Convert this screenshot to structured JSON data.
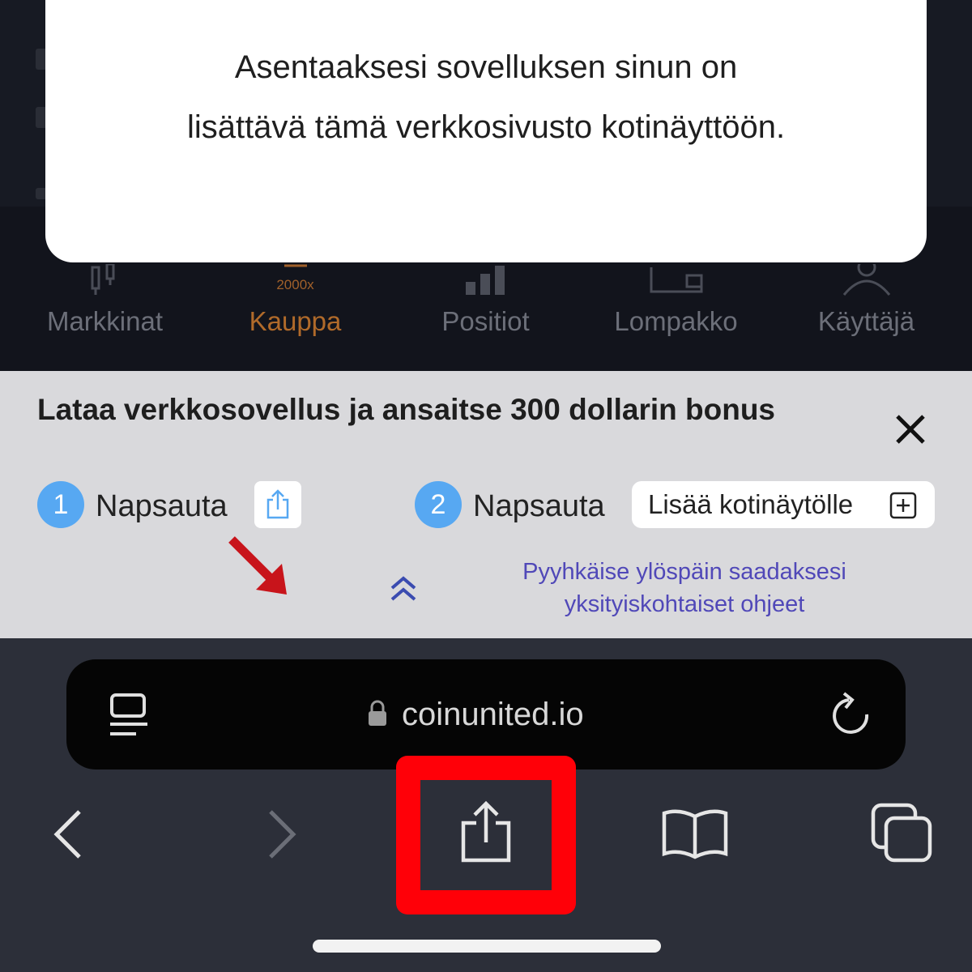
{
  "modal": {
    "line1": "Asentaaksesi sovelluksen sinun on",
    "line2": "lisättävä tämä verkkosivusto kotinäyttöön."
  },
  "tabbar": {
    "tabs": [
      {
        "label": "Markkinat",
        "icon": "chart-icon",
        "active": false
      },
      {
        "label": "Kauppa",
        "sublabel": "2000x",
        "icon": "trade-icon",
        "active": true
      },
      {
        "label": "Positiot",
        "icon": "bars-icon",
        "active": false
      },
      {
        "label": "Lompakko",
        "icon": "wallet-icon",
        "active": false
      },
      {
        "label": "Käyttäjä",
        "icon": "user-icon",
        "active": false
      }
    ]
  },
  "banner": {
    "title": "Lataa verkkosovellus ja ansaitse 300 dollarin bonus",
    "step1": {
      "number": "1",
      "text": "Napsauta"
    },
    "step2": {
      "number": "2",
      "text": "Napsauta",
      "chip": "Lisää kotinäytölle"
    },
    "swipe_hint_line1": "Pyyhkäise ylöspäin saadaksesi",
    "swipe_hint_line2": "yksityiskohtaiset ohjeet"
  },
  "browser": {
    "url": "coinunited.io",
    "toolbar_icons": [
      "back-icon",
      "forward-icon",
      "share-icon",
      "bookmarks-icon",
      "tabs-icon"
    ]
  },
  "colors": {
    "accent_orange": "#b06a2a",
    "step_blue": "#57a8f2",
    "hint_purple": "#5048b8",
    "highlight_red": "#ff0008"
  }
}
